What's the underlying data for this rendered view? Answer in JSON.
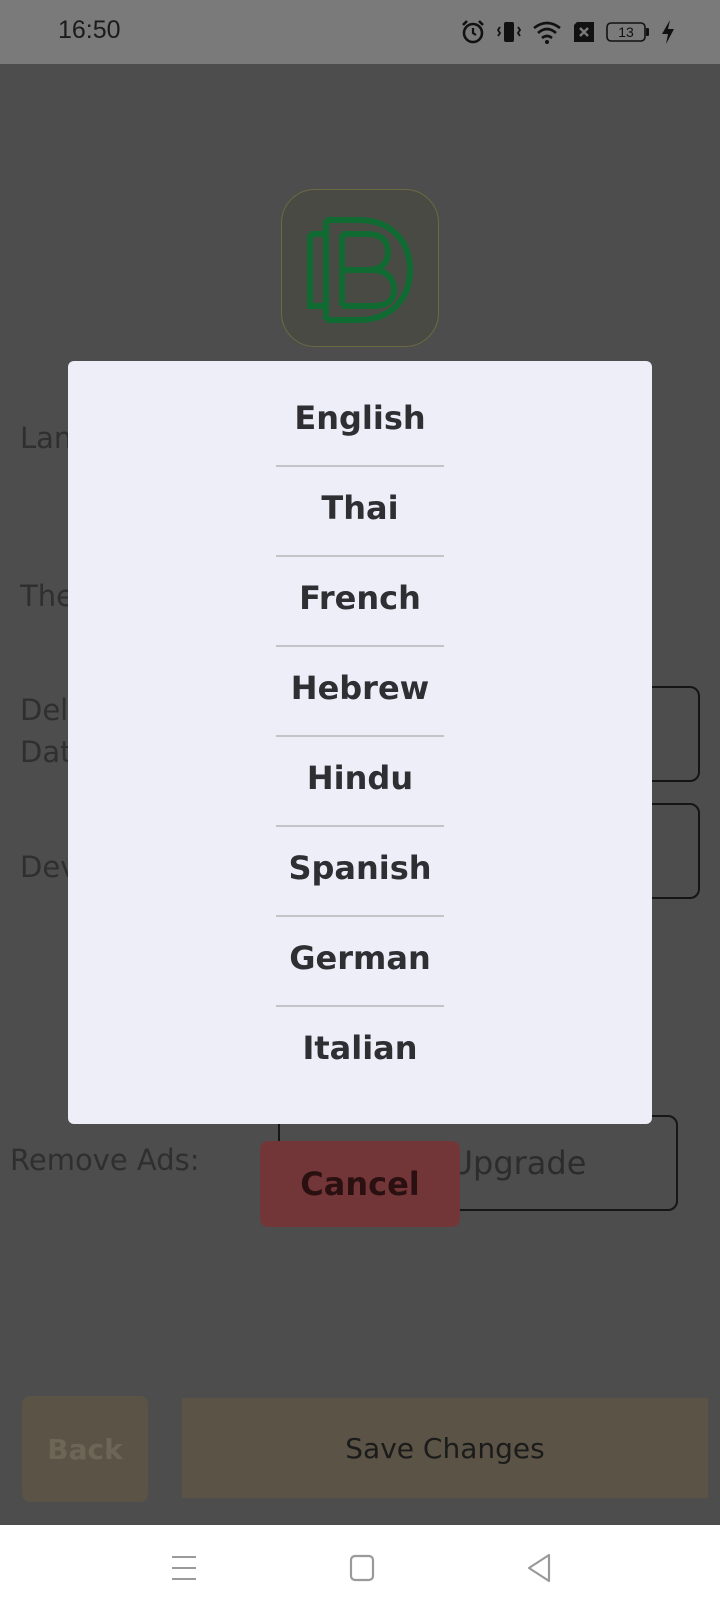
{
  "status_bar": {
    "time": "16:50",
    "battery_level": "13",
    "icons": [
      "alarm-icon",
      "vibrate-icon",
      "wifi-icon",
      "sim-error-icon",
      "battery-icon",
      "charging-icon"
    ]
  },
  "settings": {
    "language_label": "Lan",
    "theme_label": "The",
    "delete_label_line1": "Del",
    "delete_label_line2": "Dat",
    "developer_label": "Dev",
    "remove_ads_label": "Remove Ads:",
    "upgrade_label": "Upgrade"
  },
  "language_dialog": {
    "options": [
      "English",
      "Thai",
      "French",
      "Hebrew",
      "Hindu",
      "Spanish",
      "German",
      "Italian"
    ],
    "cancel_label": "Cancel"
  },
  "footer": {
    "back_label": "Back",
    "save_label": "Save Changes"
  },
  "colors": {
    "overlay": "#4d4d4e",
    "dialog_background": "#eeeef8",
    "cancel_button": "#733638",
    "footer_button": "#5b5446",
    "logo_green": "#0f6b32"
  },
  "nav_bar": {
    "icons": [
      "menu-icon",
      "home-icon",
      "back-icon"
    ]
  }
}
